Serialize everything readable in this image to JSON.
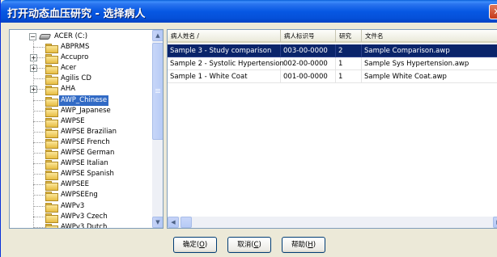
{
  "window": {
    "title": "打开动态血压研究 - 选择病人"
  },
  "tree": {
    "drive_label": "ACER (C:)",
    "items": [
      {
        "label": "ABPRMS",
        "expandable": false,
        "selected": false
      },
      {
        "label": "Accupro",
        "expandable": true,
        "selected": false
      },
      {
        "label": "Acer",
        "expandable": true,
        "selected": false
      },
      {
        "label": "Agilis CD",
        "expandable": false,
        "selected": false
      },
      {
        "label": "AHA",
        "expandable": true,
        "selected": false
      },
      {
        "label": "AWP_Chinese",
        "expandable": false,
        "selected": true
      },
      {
        "label": "AWP_Japanese",
        "expandable": false,
        "selected": false
      },
      {
        "label": "AWPSE",
        "expandable": false,
        "selected": false
      },
      {
        "label": "AWPSE Brazilian",
        "expandable": false,
        "selected": false
      },
      {
        "label": "AWPSE French",
        "expandable": false,
        "selected": false
      },
      {
        "label": "AWPSE German",
        "expandable": false,
        "selected": false
      },
      {
        "label": "AWPSE Italian",
        "expandable": false,
        "selected": false
      },
      {
        "label": "AWPSE Spanish",
        "expandable": false,
        "selected": false
      },
      {
        "label": "AWPSEE",
        "expandable": false,
        "selected": false
      },
      {
        "label": "AWPSEEng",
        "expandable": false,
        "selected": false
      },
      {
        "label": "AWPv3",
        "expandable": false,
        "selected": false
      },
      {
        "label": "AWPv3 Czech",
        "expandable": false,
        "selected": false
      },
      {
        "label": "AWPv3 Dutch",
        "expandable": false,
        "selected": false
      }
    ]
  },
  "list": {
    "columns": [
      "病人姓名 /",
      "病人标识号",
      "研究",
      "文件名"
    ],
    "rows": [
      [
        "Sample 3 - Study comparison",
        "003-00-0000",
        "2",
        "Sample Comparison.awp"
      ],
      [
        "Sample 2 - Systolic Hypertension",
        "002-00-0000",
        "1",
        "Sample Sys Hypertension.awp"
      ],
      [
        "Sample 1 - White Coat",
        "001-00-0000",
        "1",
        "Sample White Coat.awp"
      ]
    ],
    "selected_row": 0
  },
  "buttons": {
    "ok": {
      "label": "确定(",
      "key": "O",
      "end": ")"
    },
    "cancel": {
      "label": "取消(",
      "key": "C",
      "end": ")"
    },
    "help": {
      "label": "帮助(",
      "key": "H",
      "end": ")"
    }
  },
  "icons": {
    "close": "close-icon",
    "expand": "plus-box-icon",
    "collapse": "minus-box-icon",
    "folder": "folder-icon",
    "drive": "drive-icon"
  },
  "colors": {
    "titlebar": "#0758e3",
    "selection": "#0a246a",
    "tree_selection": "#316ac5",
    "dialog_bg": "#ece9d8"
  }
}
